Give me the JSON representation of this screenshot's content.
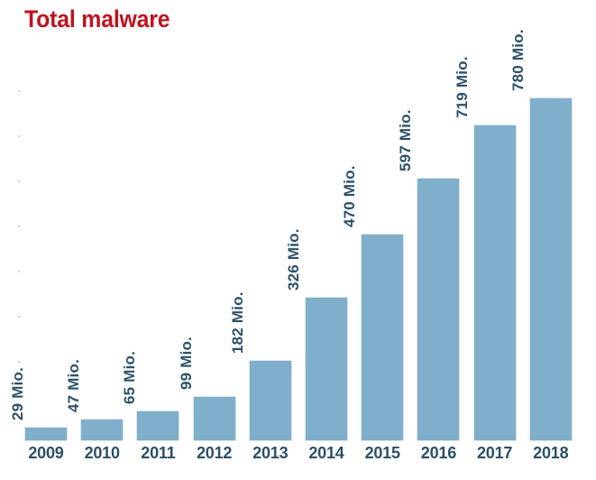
{
  "chart_data": {
    "type": "bar",
    "title": "Total malware",
    "xlabel": "",
    "ylabel": "",
    "categories": [
      "2009",
      "2010",
      "2011",
      "2012",
      "2013",
      "2014",
      "2015",
      "2016",
      "2017",
      "2018"
    ],
    "values": [
      29,
      47,
      65,
      99,
      182,
      326,
      470,
      597,
      719,
      780
    ],
    "value_unit": "Mio.",
    "value_labels": [
      "29 Mio.",
      "47 Mio.",
      "65 Mio.",
      "99 Mio.",
      "182 Mio.",
      "326 Mio.",
      "470 Mio.",
      "597 Mio.",
      "719 Mio.",
      "780 Mio."
    ],
    "ylim": [
      0,
      780
    ],
    "grid": false,
    "legend": "none",
    "value_label_rotation": "90deg-ccw",
    "colors": {
      "bar": "#7fafca",
      "title": "#c1121f",
      "label": "#2b5067",
      "background": "#ffffff",
      "tick": "#b9c3ca"
    }
  },
  "axis": {
    "y_tick_count": 8
  }
}
